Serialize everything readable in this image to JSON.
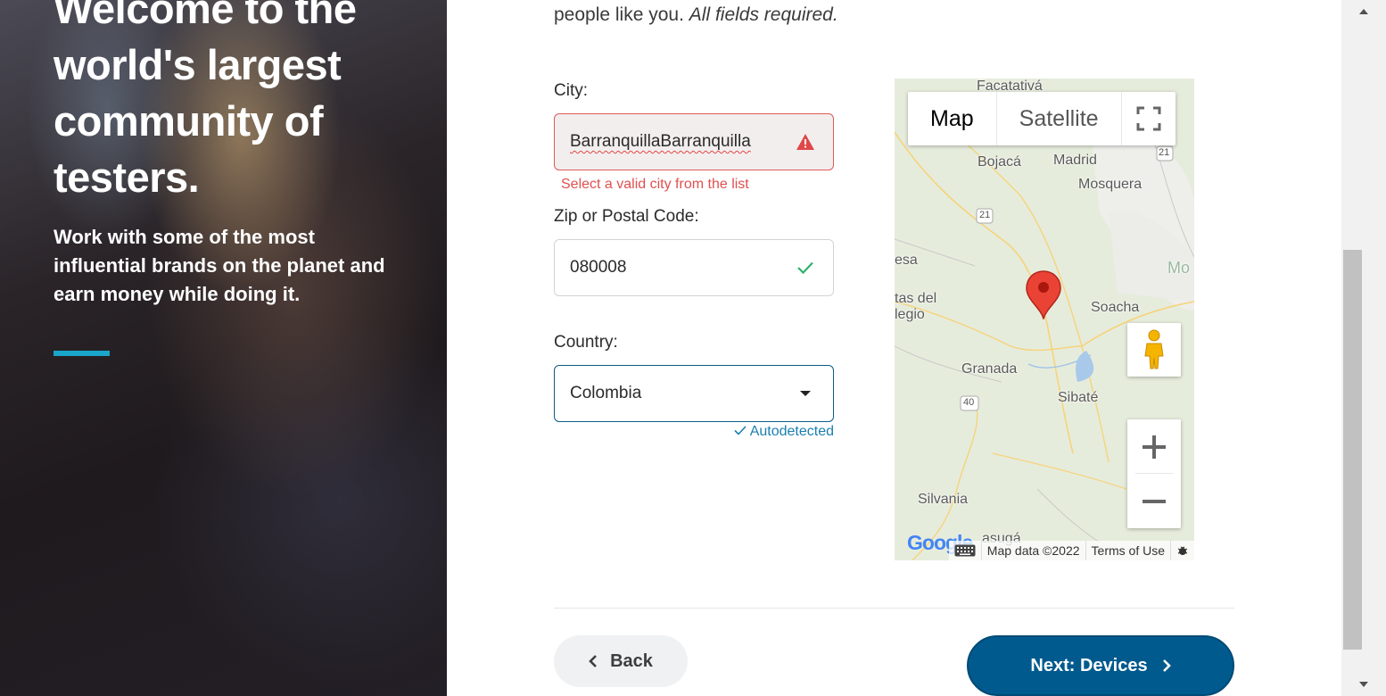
{
  "hero": {
    "title": "Welcome to the world's largest community of testers.",
    "subtitle": "Work with some of the most influential brands on the planet and earn money while doing it."
  },
  "form": {
    "intro_text": "people like you. ",
    "intro_emphasis": "All fields required.",
    "city": {
      "label": "City:",
      "value": "BarranquillaBarranquilla",
      "error": "Select a valid city from the list",
      "status_icon": "warning-triangle-icon"
    },
    "zip": {
      "label": "Zip or Postal Code:",
      "value": "080008",
      "status_icon": "check-icon"
    },
    "country": {
      "label": "Country:",
      "value": "Colombia",
      "autodetected": "Autodetected"
    }
  },
  "map": {
    "tabs": [
      {
        "label": "Map",
        "active": true
      },
      {
        "label": "Satellite",
        "active": false
      }
    ],
    "places": [
      "Facatativá",
      "Bojacá",
      "Madrid",
      "Mosquera",
      "Mo",
      "esa",
      "tas del",
      "legio",
      "Soacha",
      "Granada",
      "Sibaté",
      "Silvania",
      "asugá"
    ],
    "route_numbers": [
      "21",
      "21",
      "40"
    ],
    "logo": "Google",
    "footer": {
      "map_data": "Map data ©2022",
      "terms": "Terms of Use"
    }
  },
  "buttons": {
    "back": "Back",
    "next": "Next: Devices"
  },
  "colors": {
    "accent": "#1aa6c9",
    "primary": "#005a8e",
    "error": "#e05050",
    "success": "#2fb36b",
    "link": "#1b7fb0"
  }
}
